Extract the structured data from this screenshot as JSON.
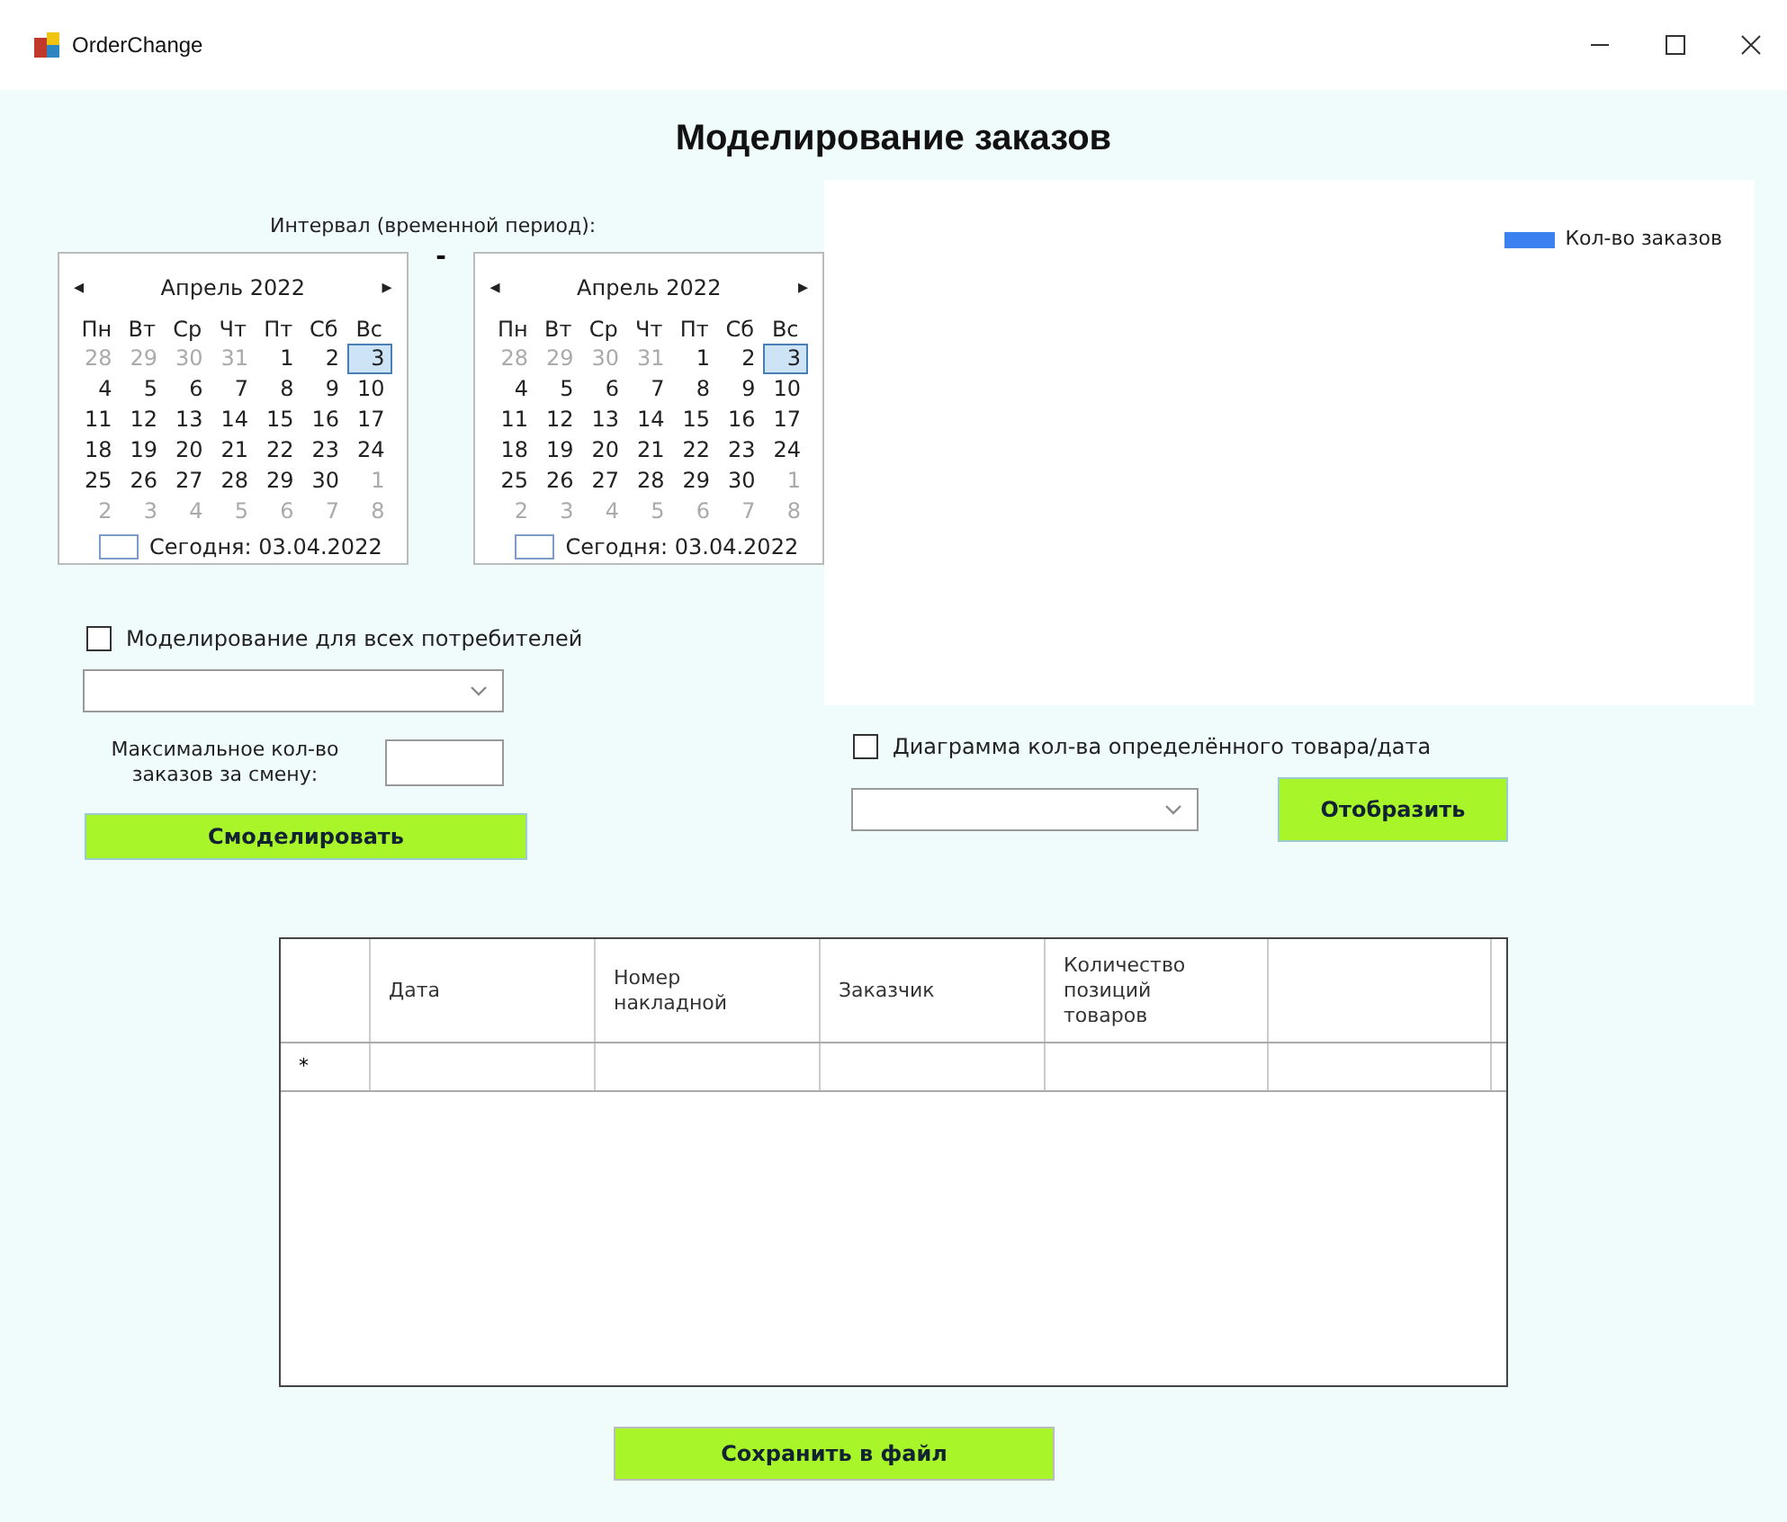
{
  "window": {
    "title": "OrderChange"
  },
  "heading": "Моделирование заказов",
  "interval_label": "Интервал (временной период):",
  "range_separator": "-",
  "calendars": [
    {
      "month": "Апрель 2022",
      "prev": "◂",
      "next": "▸",
      "weekdays": [
        "Пн",
        "Вт",
        "Ср",
        "Чт",
        "Пт",
        "Сб",
        "Вс"
      ],
      "weeks": [
        [
          {
            "day": "28",
            "other_month": true,
            "selected": false
          },
          {
            "day": "29",
            "other_month": true,
            "selected": false
          },
          {
            "day": "30",
            "other_month": true,
            "selected": false
          },
          {
            "day": "31",
            "other_month": true,
            "selected": false
          },
          {
            "day": "1",
            "other_month": false,
            "selected": false
          },
          {
            "day": "2",
            "other_month": false,
            "selected": false
          },
          {
            "day": "3",
            "other_month": false,
            "selected": true
          }
        ],
        [
          {
            "day": "4",
            "other_month": false,
            "selected": false
          },
          {
            "day": "5",
            "other_month": false,
            "selected": false
          },
          {
            "day": "6",
            "other_month": false,
            "selected": false
          },
          {
            "day": "7",
            "other_month": false,
            "selected": false
          },
          {
            "day": "8",
            "other_month": false,
            "selected": false
          },
          {
            "day": "9",
            "other_month": false,
            "selected": false
          },
          {
            "day": "10",
            "other_month": false,
            "selected": false
          }
        ],
        [
          {
            "day": "11",
            "other_month": false,
            "selected": false
          },
          {
            "day": "12",
            "other_month": false,
            "selected": false
          },
          {
            "day": "13",
            "other_month": false,
            "selected": false
          },
          {
            "day": "14",
            "other_month": false,
            "selected": false
          },
          {
            "day": "15",
            "other_month": false,
            "selected": false
          },
          {
            "day": "16",
            "other_month": false,
            "selected": false
          },
          {
            "day": "17",
            "other_month": false,
            "selected": false
          }
        ],
        [
          {
            "day": "18",
            "other_month": false,
            "selected": false
          },
          {
            "day": "19",
            "other_month": false,
            "selected": false
          },
          {
            "day": "20",
            "other_month": false,
            "selected": false
          },
          {
            "day": "21",
            "other_month": false,
            "selected": false
          },
          {
            "day": "22",
            "other_month": false,
            "selected": false
          },
          {
            "day": "23",
            "other_month": false,
            "selected": false
          },
          {
            "day": "24",
            "other_month": false,
            "selected": false
          }
        ],
        [
          {
            "day": "25",
            "other_month": false,
            "selected": false
          },
          {
            "day": "26",
            "other_month": false,
            "selected": false
          },
          {
            "day": "27",
            "other_month": false,
            "selected": false
          },
          {
            "day": "28",
            "other_month": false,
            "selected": false
          },
          {
            "day": "29",
            "other_month": false,
            "selected": false
          },
          {
            "day": "30",
            "other_month": false,
            "selected": false
          },
          {
            "day": "1",
            "other_month": true,
            "selected": false
          }
        ],
        [
          {
            "day": "2",
            "other_month": true,
            "selected": false
          },
          {
            "day": "3",
            "other_month": true,
            "selected": false
          },
          {
            "day": "4",
            "other_month": true,
            "selected": false
          },
          {
            "day": "5",
            "other_month": true,
            "selected": false
          },
          {
            "day": "6",
            "other_month": true,
            "selected": false
          },
          {
            "day": "7",
            "other_month": true,
            "selected": false
          },
          {
            "day": "8",
            "other_month": true,
            "selected": false
          }
        ]
      ],
      "today": "Сегодня: 03.04.2022"
    },
    {
      "month": "Апрель 2022",
      "prev": "◂",
      "next": "▸",
      "weekdays": [
        "Пн",
        "Вт",
        "Ср",
        "Чт",
        "Пт",
        "Сб",
        "Вс"
      ],
      "weeks": [
        [
          {
            "day": "28",
            "other_month": true,
            "selected": false
          },
          {
            "day": "29",
            "other_month": true,
            "selected": false
          },
          {
            "day": "30",
            "other_month": true,
            "selected": false
          },
          {
            "day": "31",
            "other_month": true,
            "selected": false
          },
          {
            "day": "1",
            "other_month": false,
            "selected": false
          },
          {
            "day": "2",
            "other_month": false,
            "selected": false
          },
          {
            "day": "3",
            "other_month": false,
            "selected": true
          }
        ],
        [
          {
            "day": "4",
            "other_month": false,
            "selected": false
          },
          {
            "day": "5",
            "other_month": false,
            "selected": false
          },
          {
            "day": "6",
            "other_month": false,
            "selected": false
          },
          {
            "day": "7",
            "other_month": false,
            "selected": false
          },
          {
            "day": "8",
            "other_month": false,
            "selected": false
          },
          {
            "day": "9",
            "other_month": false,
            "selected": false
          },
          {
            "day": "10",
            "other_month": false,
            "selected": false
          }
        ],
        [
          {
            "day": "11",
            "other_month": false,
            "selected": false
          },
          {
            "day": "12",
            "other_month": false,
            "selected": false
          },
          {
            "day": "13",
            "other_month": false,
            "selected": false
          },
          {
            "day": "14",
            "other_month": false,
            "selected": false
          },
          {
            "day": "15",
            "other_month": false,
            "selected": false
          },
          {
            "day": "16",
            "other_month": false,
            "selected": false
          },
          {
            "day": "17",
            "other_month": false,
            "selected": false
          }
        ],
        [
          {
            "day": "18",
            "other_month": false,
            "selected": false
          },
          {
            "day": "19",
            "other_month": false,
            "selected": false
          },
          {
            "day": "20",
            "other_month": false,
            "selected": false
          },
          {
            "day": "21",
            "other_month": false,
            "selected": false
          },
          {
            "day": "22",
            "other_month": false,
            "selected": false
          },
          {
            "day": "23",
            "other_month": false,
            "selected": false
          },
          {
            "day": "24",
            "other_month": false,
            "selected": false
          }
        ],
        [
          {
            "day": "25",
            "other_month": false,
            "selected": false
          },
          {
            "day": "26",
            "other_month": false,
            "selected": false
          },
          {
            "day": "27",
            "other_month": false,
            "selected": false
          },
          {
            "day": "28",
            "other_month": false,
            "selected": false
          },
          {
            "day": "29",
            "other_month": false,
            "selected": false
          },
          {
            "day": "30",
            "other_month": false,
            "selected": false
          },
          {
            "day": "1",
            "other_month": true,
            "selected": false
          }
        ],
        [
          {
            "day": "2",
            "other_month": true,
            "selected": false
          },
          {
            "day": "3",
            "other_month": true,
            "selected": false
          },
          {
            "day": "4",
            "other_month": true,
            "selected": false
          },
          {
            "day": "5",
            "other_month": true,
            "selected": false
          },
          {
            "day": "6",
            "other_month": true,
            "selected": false
          },
          {
            "day": "7",
            "other_month": true,
            "selected": false
          },
          {
            "day": "8",
            "other_month": true,
            "selected": false
          }
        ]
      ],
      "today": "Сегодня: 03.04.2022"
    }
  ],
  "all_consumers": {
    "label": "Моделирование для всех потребителей",
    "checked": false
  },
  "max_orders": {
    "label": "Максимальное кол-во заказов за смену:"
  },
  "simulate_button": "Смоделировать",
  "chart": {
    "legend": "Кол-во заказов"
  },
  "product_chart": {
    "label": "Диаграмма кол-ва определённого товара/дата",
    "checked": false
  },
  "show_button": "Отобразить",
  "table": {
    "columns": [
      "Дата",
      "Номер накладной",
      "Заказчик",
      "Количество позиций товаров",
      ""
    ],
    "new_row_marker": "*"
  },
  "save_button": "Сохранить в файл"
}
